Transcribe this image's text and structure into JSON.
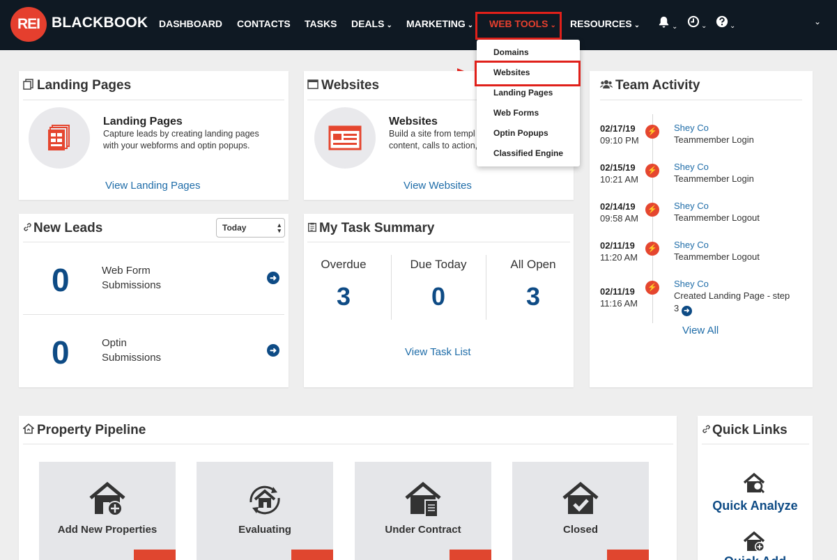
{
  "brand": {
    "logo_badge": "REI",
    "logo_text": "BLACKBOOK"
  },
  "nav": {
    "items": [
      {
        "label": "DASHBOARD"
      },
      {
        "label": "CONTACTS"
      },
      {
        "label": "TASKS"
      },
      {
        "label": "DEALS"
      },
      {
        "label": "MARKETING"
      },
      {
        "label": "WEB TOOLS"
      },
      {
        "label": "RESOURCES"
      }
    ],
    "icons": [
      "bell-icon",
      "clock-icon",
      "help-icon"
    ],
    "chevron": "⌄"
  },
  "web_tools_menu": {
    "items": [
      "Domains",
      "Websites",
      "Landing Pages",
      "Web Forms",
      "Optin Popups",
      "Classified Engine"
    ]
  },
  "landing_pages": {
    "title": "Landing Pages",
    "feature_title": "Landing Pages",
    "feature_desc": "Capture leads by creating landing pages with your webforms and optin popups.",
    "link": "View Landing Pages"
  },
  "websites": {
    "title": "Websites",
    "feature_title": "Websites",
    "feature_desc_1": "Build a site from templ",
    "feature_desc_2": "content, calls to action,",
    "link": "View Websites"
  },
  "new_leads": {
    "title": "New Leads",
    "filter": "Today",
    "rows": [
      {
        "count": "0",
        "label_1": "Web Form",
        "label_2": "Submissions"
      },
      {
        "count": "0",
        "label_1": "Optin",
        "label_2": "Submissions"
      }
    ]
  },
  "task_summary": {
    "title": "My Task Summary",
    "columns": [
      {
        "label": "Overdue",
        "value": "3"
      },
      {
        "label": "Due Today",
        "value": "0"
      },
      {
        "label": "All Open",
        "value": "3"
      }
    ],
    "link": "View Task List"
  },
  "team_activity": {
    "title": "Team Activity",
    "entries": [
      {
        "date": "02/17/19",
        "time": "09:10 PM",
        "name": "Shey Co",
        "action": "Teammember Login"
      },
      {
        "date": "02/15/19",
        "time": "10:21 AM",
        "name": "Shey Co",
        "action": "Teammember Login"
      },
      {
        "date": "02/14/19",
        "time": "09:58 AM",
        "name": "Shey Co",
        "action": "Teammember Logout"
      },
      {
        "date": "02/11/19",
        "time": "11:20 AM",
        "name": "Shey Co",
        "action": "Teammember Logout"
      },
      {
        "date": "02/11/19",
        "time": "11:16 AM",
        "name": "Shey Co",
        "action": "Created Landing Page - step",
        "action_2": "3"
      }
    ],
    "link": "View All"
  },
  "pipeline": {
    "title": "Property Pipeline",
    "stages": [
      {
        "label": "Add New Properties",
        "icon": "house-plus-icon"
      },
      {
        "label": "Evaluating",
        "icon": "house-cycle-icon"
      },
      {
        "label": "Under Contract",
        "icon": "house-document-icon"
      },
      {
        "label": "Closed",
        "icon": "house-check-icon"
      }
    ]
  },
  "quick_links": {
    "title": "Quick Links",
    "items": [
      {
        "label": "Quick Analyze",
        "icon": "house-search-icon"
      },
      {
        "label": "Quick Add",
        "icon": "house-plus-icon"
      }
    ]
  },
  "colors": {
    "nav_bg": "#0f1923",
    "accent": "#e53f2e",
    "link": "#1e6ca8",
    "number": "#0e4b85"
  }
}
